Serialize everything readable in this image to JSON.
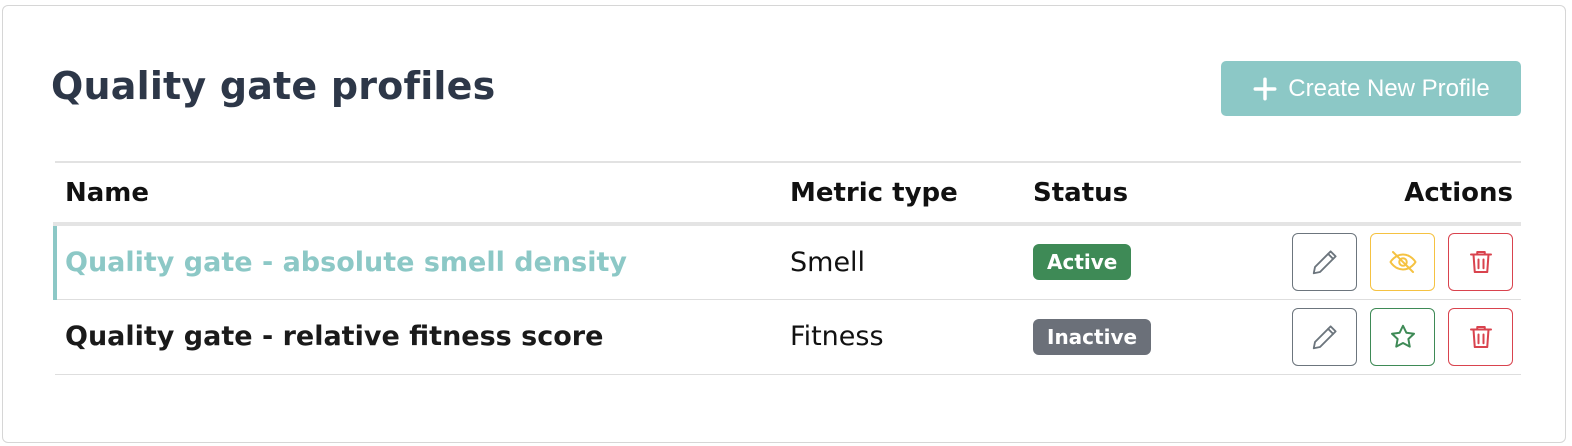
{
  "header": {
    "title": "Quality gate profiles",
    "create_button_label": "Create New Profile"
  },
  "table": {
    "columns": [
      "Name",
      "Metric type",
      "Status",
      "Actions"
    ],
    "rows": [
      {
        "name": "Quality gate - absolute smell density",
        "metric_type": "Smell",
        "status": "Active",
        "selected": true
      },
      {
        "name": "Quality gate - relative fitness score",
        "metric_type": "Fitness",
        "status": "Inactive",
        "selected": false
      }
    ]
  },
  "icons": {
    "create": "plus-icon",
    "edit": "pencil-icon",
    "deactivate": "eye-slash-icon",
    "activate": "star-icon",
    "delete": "trash-icon"
  },
  "colors": {
    "accent": "#8cc8c6",
    "active_badge": "#3e8a56",
    "inactive_badge": "#6b7079",
    "warning_outline": "#f5c242",
    "danger_outline": "#d9434e",
    "success_outline": "#3e8a56",
    "secondary_outline": "#6c757d"
  }
}
